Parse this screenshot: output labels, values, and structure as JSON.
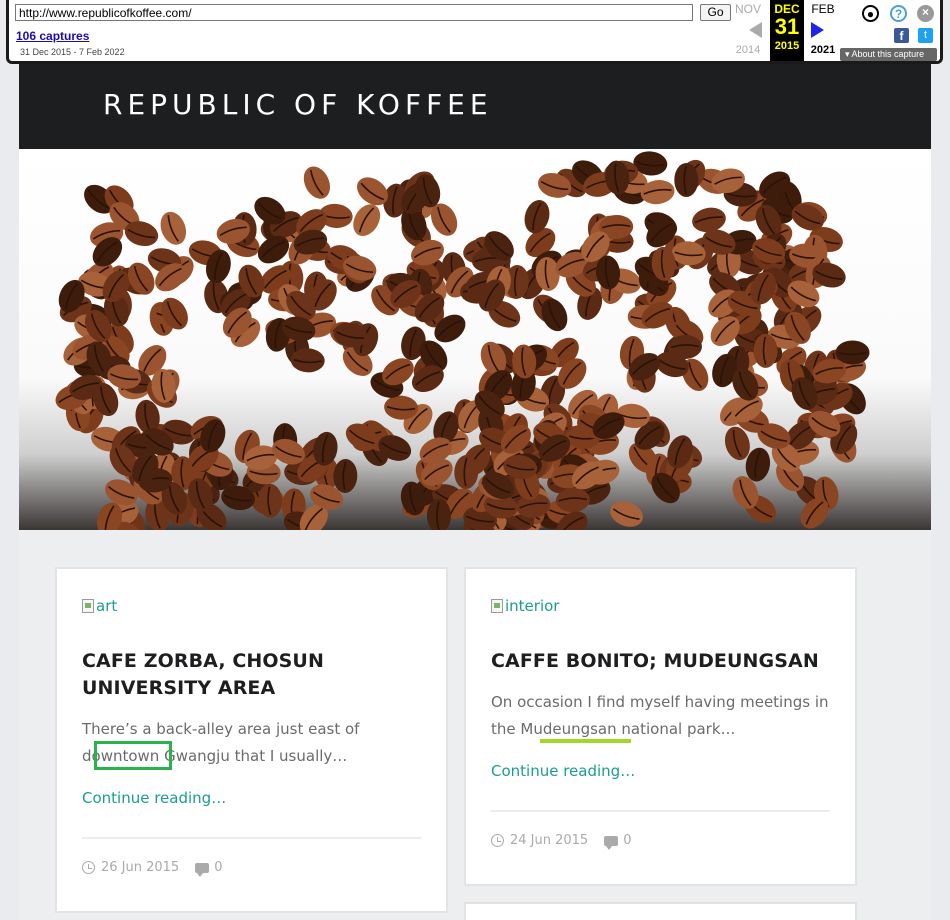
{
  "wayback": {
    "url": "http://www.republicofkoffee.com/",
    "go_label": "Go",
    "captures_label": "106 captures",
    "date_range": "31 Dec 2015 - 7 Feb 2022",
    "prev": {
      "month": "NOV",
      "year": "2014"
    },
    "current": {
      "month": "DEC",
      "day": "31",
      "year": "2015"
    },
    "next": {
      "month": "FEB",
      "year": "2021"
    },
    "about_label": "About this capture",
    "icons": [
      "user-icon",
      "help-icon",
      "close-icon",
      "facebook-icon",
      "twitter-icon"
    ]
  },
  "site": {
    "title": "REPUBLIC OF KOFFEE",
    "header_color": "#1d1e20",
    "accent_color": "#1a9e8f"
  },
  "posts": [
    {
      "image_alt": "art",
      "title": "CAFE ZORBA, CHOSUN UNIVERSITY AREA",
      "excerpt": "There’s a back-alley area just east of downtown Gwangju that I usually…",
      "more": "Continue reading…",
      "date": "26 Jun 2015",
      "comments": "0"
    },
    {
      "image_alt": "interior",
      "title": "CAFFE BONITO; MUDEUNGSAN",
      "excerpt": "On occasion I find myself having meetings in the Mudeungsan national park…",
      "more": "Continue reading…",
      "date": "24 Jun 2015",
      "comments": "0"
    }
  ]
}
